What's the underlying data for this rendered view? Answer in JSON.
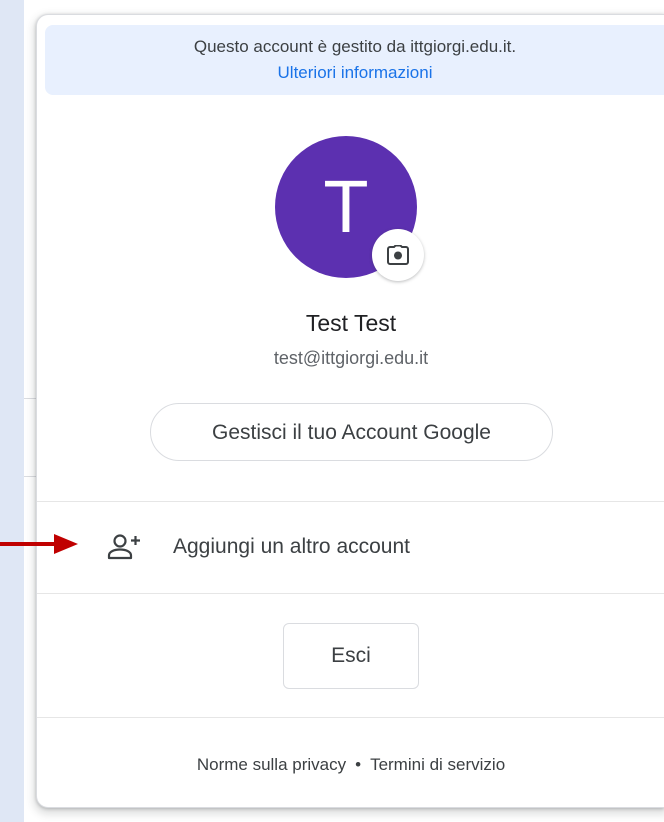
{
  "banner": {
    "managed_text": "Questo account è gestito da ittgiorgi.edu.it.",
    "more_info_link": "Ulteriori informazioni"
  },
  "account": {
    "avatar_initial": "T",
    "avatar_color": "#5c30b0",
    "name": "Test Test",
    "email": "test@ittgiorgi.edu.it",
    "camera_icon": "camera-icon"
  },
  "manage_button": {
    "label": "Gestisci il tuo Account Google"
  },
  "add_account": {
    "label": "Aggiungi un altro account",
    "icon": "person-add-icon"
  },
  "signout_button": {
    "label": "Esci"
  },
  "footer": {
    "privacy_link": "Norme sulla privacy",
    "separator": "•",
    "terms_link": "Termini di servizio"
  },
  "annotation": {
    "arrow_color": "#c00000"
  },
  "colors": {
    "link_blue": "#1a73e8",
    "banner_bg": "#e8f0fe"
  }
}
